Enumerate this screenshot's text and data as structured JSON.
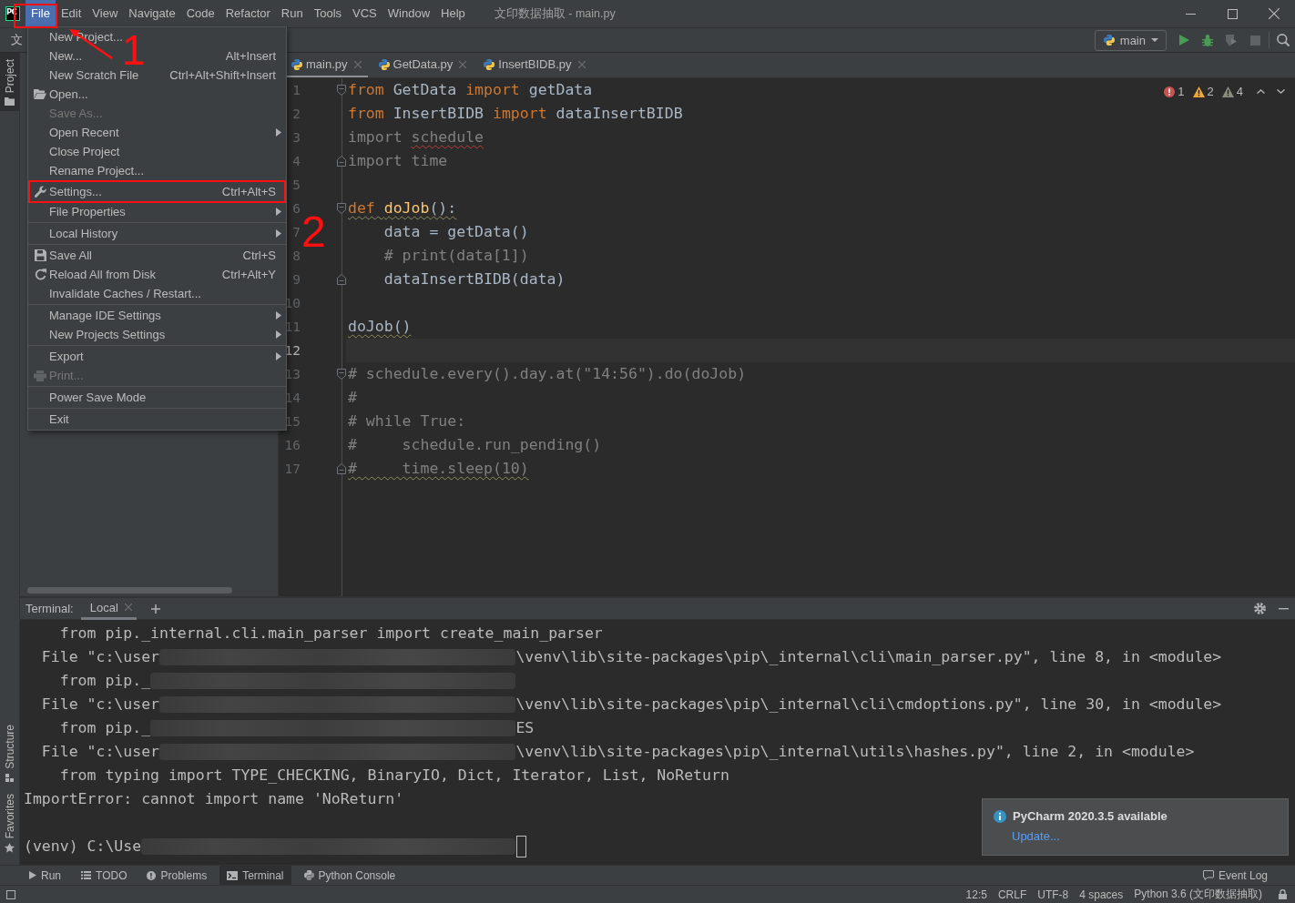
{
  "title_bar": {
    "logo": "PC",
    "menus": [
      {
        "label": "File",
        "selected": true,
        "marked": true
      },
      {
        "label": "Edit",
        "selected": false,
        "marked": false
      },
      {
        "label": "View",
        "selected": false,
        "marked": false
      },
      {
        "label": "Navigate",
        "selected": false,
        "marked": false
      },
      {
        "label": "Code",
        "selected": false,
        "marked": false
      },
      {
        "label": "Refactor",
        "selected": false,
        "marked": false
      },
      {
        "label": "Run",
        "selected": false,
        "marked": false
      },
      {
        "label": "Tools",
        "selected": false,
        "marked": false
      },
      {
        "label": "VCS",
        "selected": false,
        "marked": false
      },
      {
        "label": "Window",
        "selected": false,
        "marked": false
      },
      {
        "label": "Help",
        "selected": false,
        "marked": false
      }
    ],
    "title": "文印数据抽取 - main.py"
  },
  "nav_bar": {
    "breadcrumb": "文",
    "run_config": "main",
    "run_actions": [
      {
        "disabled": false
      },
      {
        "disabled": false
      },
      {
        "disabled": true
      },
      {
        "disabled": true
      }
    ]
  },
  "left_stripe": {
    "top": [
      {
        "label": "Project",
        "selected": true
      }
    ],
    "bottom": [
      {
        "label": "Structure",
        "selected": false
      },
      {
        "label": "Favorites",
        "selected": false
      }
    ]
  },
  "file_menu": [
    {
      "kind": "item",
      "label": "New Project...",
      "disabled": false,
      "submenu": false,
      "marked": false
    },
    {
      "kind": "item",
      "label": "New...",
      "shortcut": "Alt+Insert",
      "disabled": false,
      "submenu": false,
      "marked": false
    },
    {
      "kind": "item",
      "label": "New Scratch File",
      "shortcut": "Ctrl+Alt+Shift+Insert",
      "disabled": false,
      "submenu": false,
      "marked": false
    },
    {
      "kind": "item",
      "label": "Open...",
      "disabled": false,
      "submenu": false,
      "marked": false
    },
    {
      "kind": "item",
      "label": "Save As...",
      "disabled": true,
      "submenu": false,
      "marked": false
    },
    {
      "kind": "item",
      "label": "Open Recent",
      "disabled": false,
      "submenu": true,
      "marked": false
    },
    {
      "kind": "item",
      "label": "Close Project",
      "disabled": false,
      "submenu": false,
      "marked": false
    },
    {
      "kind": "item",
      "label": "Rename Project...",
      "disabled": false,
      "submenu": false,
      "marked": false
    },
    {
      "kind": "separator"
    },
    {
      "kind": "item",
      "label": "Settings...",
      "shortcut": "Ctrl+Alt+S",
      "disabled": false,
      "submenu": false,
      "marked": true
    },
    {
      "kind": "item",
      "label": "File Properties",
      "disabled": false,
      "submenu": true,
      "marked": false
    },
    {
      "kind": "separator"
    },
    {
      "kind": "item",
      "label": "Local History",
      "disabled": false,
      "submenu": true,
      "marked": false
    },
    {
      "kind": "separator"
    },
    {
      "kind": "item",
      "label": "Save All",
      "shortcut": "Ctrl+S",
      "disabled": false,
      "submenu": false,
      "marked": false
    },
    {
      "kind": "item",
      "label": "Reload All from Disk",
      "shortcut": "Ctrl+Alt+Y",
      "disabled": false,
      "submenu": false,
      "marked": false
    },
    {
      "kind": "item",
      "label": "Invalidate Caches / Restart...",
      "disabled": false,
      "submenu": false,
      "marked": false
    },
    {
      "kind": "separator"
    },
    {
      "kind": "item",
      "label": "Manage IDE Settings",
      "disabled": false,
      "submenu": true,
      "marked": false
    },
    {
      "kind": "item",
      "label": "New Projects Settings",
      "disabled": false,
      "submenu": true,
      "marked": false
    },
    {
      "kind": "separator"
    },
    {
      "kind": "item",
      "label": "Export",
      "disabled": false,
      "submenu": true,
      "marked": false
    },
    {
      "kind": "item",
      "label": "Print...",
      "disabled": true,
      "submenu": false,
      "marked": false
    },
    {
      "kind": "separator"
    },
    {
      "kind": "item",
      "label": "Power Save Mode",
      "disabled": false,
      "submenu": false,
      "marked": false
    },
    {
      "kind": "separator"
    },
    {
      "kind": "item",
      "label": "Exit",
      "disabled": false,
      "submenu": false,
      "marked": false
    }
  ],
  "editor": {
    "tabs": [
      {
        "label": "main.py",
        "selected": true
      },
      {
        "label": "GetData.py",
        "selected": false
      },
      {
        "label": "InsertBIDB.py",
        "selected": false
      }
    ],
    "inspections": {
      "errors": "1",
      "warnings": "2",
      "weak_warnings": "4"
    },
    "lines": [
      {
        "number": "1",
        "current": false,
        "warning": false,
        "fold_start": true,
        "fold_end": false,
        "tokens": [
          {
            "text": "from",
            "kind": "keyword",
            "error": false
          },
          {
            "text": " GetData ",
            "kind": "name",
            "error": false
          },
          {
            "text": "import",
            "kind": "keyword",
            "error": false
          },
          {
            "text": " getData",
            "kind": "name",
            "error": false
          }
        ]
      },
      {
        "number": "2",
        "current": false,
        "warning": false,
        "fold_start": false,
        "fold_end": false,
        "tokens": [
          {
            "text": "from",
            "kind": "keyword",
            "error": false
          },
          {
            "text": " InsertBIDB ",
            "kind": "name",
            "error": false
          },
          {
            "text": "import",
            "kind": "keyword",
            "error": false
          },
          {
            "text": " dataInsertBIDB",
            "kind": "name",
            "error": false
          }
        ]
      },
      {
        "number": "3",
        "current": false,
        "warning": false,
        "fold_start": false,
        "fold_end": false,
        "tokens": [
          {
            "text": "import ",
            "kind": "unused",
            "error": false
          },
          {
            "text": "schedule",
            "kind": "unused",
            "error": true
          }
        ]
      },
      {
        "number": "4",
        "current": false,
        "warning": false,
        "fold_start": false,
        "fold_end": true,
        "tokens": [
          {
            "text": "import time",
            "kind": "unused",
            "error": false
          }
        ]
      },
      {
        "number": "5",
        "current": false,
        "fold_start": false,
        "fold_end": false
      },
      {
        "number": "6",
        "current": false,
        "warning": true,
        "fold_start": true,
        "fold_end": false,
        "tokens": [
          {
            "text": "def ",
            "kind": "keyword",
            "error": false
          },
          {
            "text": "doJob",
            "kind": "function",
            "error": false
          },
          {
            "text": "():",
            "kind": "name",
            "error": false
          }
        ],
        "children": [
          {
            "number": "7",
            "current": false,
            "warning": false,
            "fold_start": false,
            "fold_end": false,
            "tokens": [
              {
                "text": "data = getData()",
                "kind": "name",
                "error": false
              }
            ]
          },
          {
            "number": "8",
            "current": false,
            "warning": false,
            "fold_start": false,
            "fold_end": false,
            "tokens": [
              {
                "text": "# print(data[1])",
                "kind": "comment",
                "error": false
              }
            ]
          },
          {
            "number": "9",
            "current": false,
            "warning": false,
            "fold_start": false,
            "fold_end": true,
            "tokens": [
              {
                "text": "dataInsertBIDB(data)",
                "kind": "name",
                "error": false
              }
            ]
          }
        ]
      },
      {
        "number": "10",
        "current": false,
        "fold_start": false,
        "fold_end": false
      },
      {
        "number": "11",
        "current": false,
        "warning": true,
        "fold_start": false,
        "fold_end": false,
        "tokens": [
          {
            "text": "doJob()",
            "kind": "name",
            "error": false
          }
        ]
      },
      {
        "number": "12",
        "current": true,
        "fold_start": false,
        "fold_end": false
      },
      {
        "number": "13",
        "current": false,
        "warning": false,
        "fold_start": true,
        "fold_end": false,
        "tokens": [
          {
            "text": "# schedule.every().day.at(\"14:56\").do(doJob)",
            "kind": "comment",
            "error": false
          }
        ]
      },
      {
        "number": "14",
        "current": false,
        "warning": false,
        "fold_start": false,
        "fold_end": false,
        "tokens": [
          {
            "text": "#",
            "kind": "comment",
            "error": false
          }
        ]
      },
      {
        "number": "15",
        "current": false,
        "warning": false,
        "fold_start": false,
        "fold_end": false,
        "tokens": [
          {
            "text": "# while True:",
            "kind": "comment",
            "error": false
          }
        ]
      },
      {
        "number": "16",
        "current": false,
        "warning": false,
        "fold_start": false,
        "fold_end": false,
        "tokens": [
          {
            "text": "#     schedule.run_pending()",
            "kind": "comment",
            "error": false
          }
        ]
      },
      {
        "number": "17",
        "current": false,
        "warning": true,
        "fold_start": false,
        "fold_end": true,
        "tokens": [
          {
            "text": "#     time.sleep(10)",
            "kind": "comment",
            "error": false
          }
        ]
      }
    ]
  },
  "terminal": {
    "label": "Terminal:",
    "tabs": [
      {
        "label": "Local",
        "selected": true
      }
    ],
    "lines": [
      {
        "kind": "source",
        "text": "from pip._internal.cli.main_parser import create_main_parser",
        "redacted": false
      },
      {
        "kind": "frame",
        "text": "File \"c:\\user",
        "redacted": true,
        "after": "\\venv\\lib\\site-packages\\pip\\_internal\\cli\\main_parser.py\", line 8, in <module>"
      },
      {
        "kind": "source",
        "text": "from pip._",
        "redacted": true
      },
      {
        "kind": "frame",
        "text": "File \"c:\\user",
        "redacted": true,
        "after": "\\venv\\lib\\site-packages\\pip\\_internal\\cli\\cmdoptions.py\", line 30, in <module>"
      },
      {
        "kind": "source",
        "text": "from pip._",
        "redacted": true,
        "after": "ES"
      },
      {
        "kind": "frame",
        "text": "File \"c:\\user",
        "redacted": true,
        "after": "\\venv\\lib\\site-packages\\pip\\_internal\\utils\\hashes.py\", line 2, in <module>"
      },
      {
        "kind": "source",
        "text": "from typing import TYPE_CHECKING, BinaryIO, Dict, Iterator, List, NoReturn",
        "redacted": false
      },
      {
        "kind": "error",
        "text": "ImportError: cannot import name 'NoReturn'",
        "redacted": false
      },
      {
        "kind": "prompt",
        "text": "(venv) C:\\Use",
        "redacted": true
      }
    ]
  },
  "notification": {
    "title": "PyCharm 2020.3.5 available",
    "link": "Update..."
  },
  "tool_window_bar": {
    "items": [
      {
        "label": "Run",
        "selected": false
      },
      {
        "label": "TODO",
        "selected": false
      },
      {
        "label": "Problems",
        "selected": false
      },
      {
        "label": "Terminal",
        "selected": true
      },
      {
        "label": "Python Console",
        "selected": false
      }
    ],
    "event_log": "Event Log"
  },
  "status_bar": {
    "items": [
      "12:5",
      "CRLF",
      "UTF-8",
      "4 spaces",
      "Python 3.6 (文印数据抽取)"
    ]
  },
  "annotations": [
    {
      "label": "1"
    },
    {
      "label": "2"
    }
  ]
}
